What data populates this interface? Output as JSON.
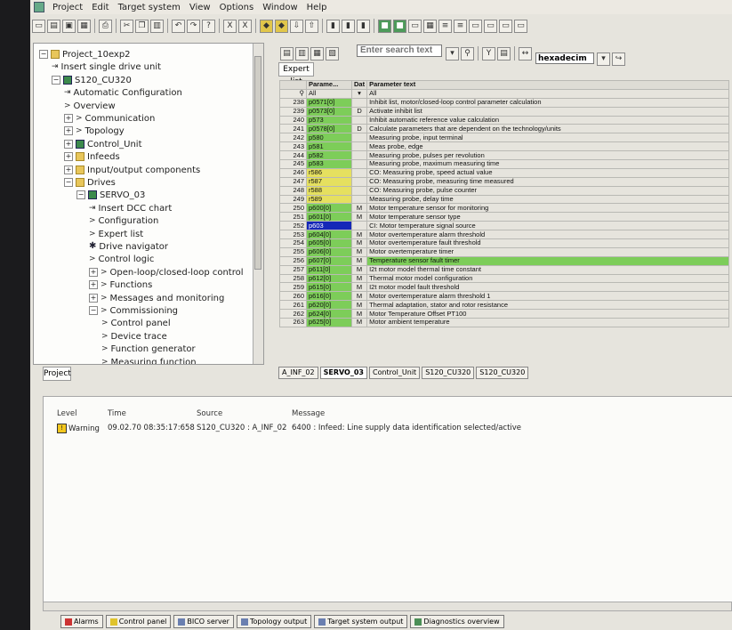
{
  "menu": [
    "Project",
    "Edit",
    "Target system",
    "View",
    "Options",
    "Window",
    "Help"
  ],
  "search": {
    "placeholder": "Enter search text"
  },
  "format": {
    "value": "hexadecim"
  },
  "tree": [
    {
      "label": "Project_10exp2",
      "indent": 0,
      "icon": "project-icon",
      "exp": "−"
    },
    {
      "label": "Insert single drive unit",
      "indent": 1,
      "icon": "insert-icon",
      "exp": ""
    },
    {
      "label": "S120_CU320",
      "indent": 1,
      "icon": "device-icon",
      "exp": "−"
    },
    {
      "label": "Automatic Configuration",
      "indent": 2,
      "icon": "insert-icon",
      "exp": ""
    },
    {
      "label": "Overview",
      "indent": 2,
      "icon": "arrow-icon",
      "exp": ""
    },
    {
      "label": "Communication",
      "indent": 2,
      "icon": "arrow-icon",
      "exp": "+"
    },
    {
      "label": "Topology",
      "indent": 2,
      "icon": "arrow-icon",
      "exp": "+"
    },
    {
      "label": "Control_Unit",
      "indent": 2,
      "icon": "drive-icon",
      "exp": "+"
    },
    {
      "label": "Infeeds",
      "indent": 2,
      "icon": "folder-icon",
      "exp": "+"
    },
    {
      "label": "Input/output components",
      "indent": 2,
      "icon": "folder-icon",
      "exp": "+"
    },
    {
      "label": "Drives",
      "indent": 2,
      "icon": "folder-icon",
      "exp": "−"
    },
    {
      "label": "SERVO_03",
      "indent": 3,
      "icon": "drive-icon",
      "exp": "−"
    },
    {
      "label": "Insert DCC chart",
      "indent": 4,
      "icon": "insert-icon",
      "exp": ""
    },
    {
      "label": "Configuration",
      "indent": 4,
      "icon": "arrow-icon",
      "exp": ""
    },
    {
      "label": "Expert list",
      "indent": 4,
      "icon": "arrow-icon",
      "exp": ""
    },
    {
      "label": "Drive navigator",
      "indent": 4,
      "icon": "star-icon",
      "exp": ""
    },
    {
      "label": "Control logic",
      "indent": 4,
      "icon": "arrow-icon",
      "exp": ""
    },
    {
      "label": "Open-loop/closed-loop control",
      "indent": 4,
      "icon": "arrow-icon",
      "exp": "+"
    },
    {
      "label": "Functions",
      "indent": 4,
      "icon": "arrow-icon",
      "exp": "+"
    },
    {
      "label": "Messages and monitoring",
      "indent": 4,
      "icon": "arrow-icon",
      "exp": "+"
    },
    {
      "label": "Commissioning",
      "indent": 4,
      "icon": "arrow-icon",
      "exp": "−"
    },
    {
      "label": "Control panel",
      "indent": 5,
      "icon": "arrow-icon",
      "exp": ""
    },
    {
      "label": "Device trace",
      "indent": 5,
      "icon": "arrow-icon",
      "exp": ""
    },
    {
      "label": "Function generator",
      "indent": 5,
      "icon": "arrow-icon",
      "exp": ""
    },
    {
      "label": "Measuring function",
      "indent": 5,
      "icon": "arrow-icon",
      "exp": ""
    }
  ],
  "project_tab": "Project",
  "expert_tab": "Expert list",
  "table": {
    "headers": [
      "",
      "Parame...",
      "Dat",
      "Parameter text"
    ],
    "filter": [
      "All",
      "All"
    ],
    "rows": [
      [
        "238",
        "p0571[0]",
        "",
        "Inhibit list, motor/closed-loop control parameter calculation",
        "lg"
      ],
      [
        "239",
        "p0573[0]",
        "D",
        "Activate inhibit list",
        "lg"
      ],
      [
        "240",
        "p573",
        "",
        "Inhibit automatic reference value calculation",
        "lg"
      ],
      [
        "241",
        "p0578[0]",
        "D",
        "Calculate parameters that are dependent on the technology/units",
        "lg"
      ],
      [
        "242",
        "p580",
        "",
        "Measuring probe, input terminal",
        "lg"
      ],
      [
        "243",
        "p581",
        "",
        "Meas probe, edge",
        "lg"
      ],
      [
        "244",
        "p582",
        "",
        "Measuring probe, pulses per revolution",
        "lg"
      ],
      [
        "245",
        "p583",
        "",
        "Measuring probe, maximum measuring time",
        "lg"
      ],
      [
        "246",
        "r586",
        "",
        "CO: Measuring probe, speed actual value",
        "yl"
      ],
      [
        "247",
        "r587",
        "",
        "CO: Measuring probe, measuring time measured",
        "yl"
      ],
      [
        "248",
        "r588",
        "",
        "CO: Measuring probe, pulse counter",
        "yl"
      ],
      [
        "249",
        "r589",
        "",
        "Measuring probe, delay time",
        "yl"
      ],
      [
        "250",
        "p600[0]",
        "M",
        "Motor temperature sensor for monitoring",
        "lg"
      ],
      [
        "251",
        "p601[0]",
        "M",
        "Motor temperature sensor type",
        "lg"
      ],
      [
        "252",
        "p603",
        "",
        "CI: Motor temperature signal source",
        "bl"
      ],
      [
        "253",
        "p604[0]",
        "M",
        "Motor overtemperature alarm threshold",
        "lg"
      ],
      [
        "254",
        "p605[0]",
        "M",
        "Motor overtemperature fault threshold",
        "lg"
      ],
      [
        "255",
        "p606[0]",
        "M",
        "Motor overtemperature timer",
        "lg"
      ],
      [
        "256",
        "p607[0]",
        "M",
        "Temperature sensor fault timer",
        "lgrow"
      ],
      [
        "257",
        "p611[0]",
        "M",
        "I2t motor model thermal time constant",
        "lg"
      ],
      [
        "258",
        "p612[0]",
        "M",
        "Thermal motor model configuration",
        "lg"
      ],
      [
        "259",
        "p615[0]",
        "M",
        "I2t motor model fault threshold",
        "lg"
      ],
      [
        "260",
        "p616[0]",
        "M",
        "Motor overtemperature alarm threshold 1",
        "lg"
      ],
      [
        "261",
        "p620[0]",
        "M",
        "Thermal adaptation, stator and rotor resistance",
        "lg"
      ],
      [
        "262",
        "p624[0]",
        "M",
        "Motor Temperature Offset PT100",
        "lg"
      ],
      [
        "263",
        "p625[0]",
        "M",
        "Motor ambient temperature",
        "lg"
      ]
    ]
  },
  "editor_tabs": [
    "A_INF_02",
    "SERVO_03",
    "Control_Unit",
    "S120_CU320",
    "S120_CU320"
  ],
  "messages": {
    "headers": {
      "level": "Level",
      "time": "Time",
      "source": "Source",
      "message": "Message"
    },
    "rows": [
      {
        "level": "Warning",
        "time": "09.02.70  08:35:17:658",
        "source": "S120_CU320 : A_INF_02",
        "message": "6400 : Infeed: Line supply data identification selected/active"
      }
    ]
  },
  "bottom_tabs": [
    "Alarms",
    "Control panel",
    "BICO server",
    "Topology output",
    "Target system output",
    "Diagnostics overview"
  ]
}
